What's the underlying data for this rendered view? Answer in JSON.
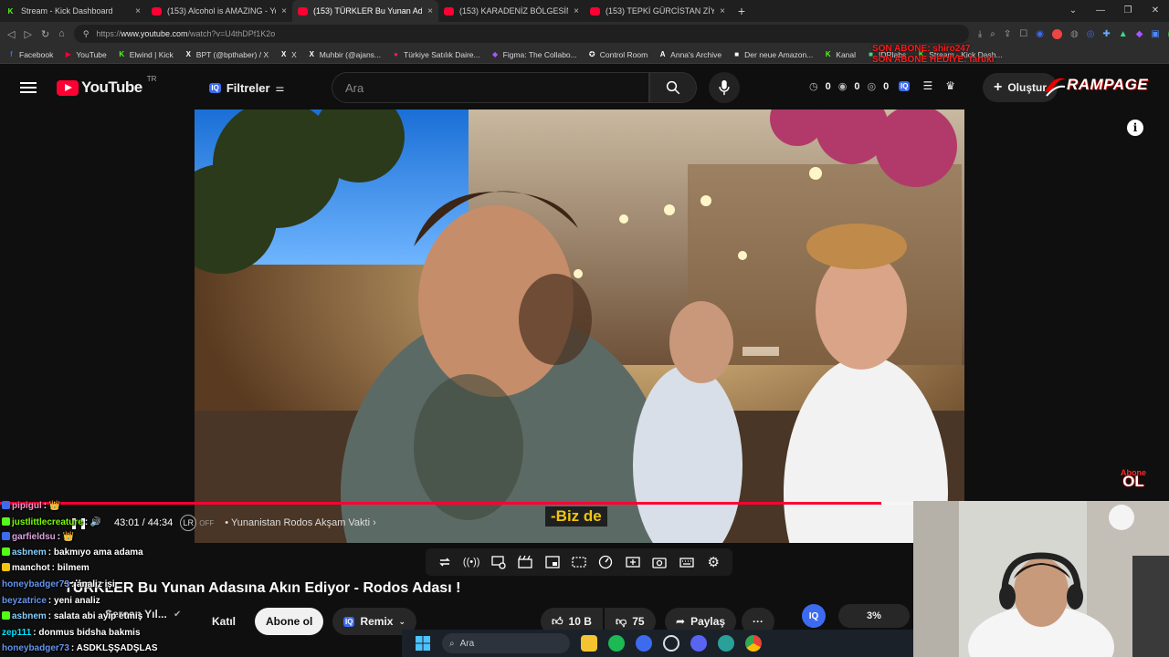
{
  "browser": {
    "tabs": [
      {
        "label": "Stream - Kick Dashboard",
        "icon": "kick"
      },
      {
        "label": "(153) Alcohol is AMAZING - You",
        "icon": "youtube"
      },
      {
        "label": "(153) TÜRKLER Bu Yunan Ad",
        "icon": "youtube"
      },
      {
        "label": "(153) KARADENİZ BÖLGESİNİN",
        "icon": "youtube"
      },
      {
        "label": "(153) TEPKİ GÜRCİSTAN ZİYARE",
        "icon": "youtube"
      }
    ],
    "active_tab_index": 2,
    "close_glyph": "×",
    "newtab_glyph": "+",
    "url_prefix": "https://",
    "url_host": "www.youtube.com",
    "url_path": "/watch?v=U4thDPf1K2o",
    "profile_initial": "U"
  },
  "bookmarks": [
    {
      "label": "Facebook",
      "icon": "f",
      "color": "#1877f2"
    },
    {
      "label": "YouTube",
      "icon": "▶",
      "color": "#ff0033"
    },
    {
      "label": "Elwind | Kick",
      "icon": "K",
      "color": "#53fc18"
    },
    {
      "label": "BPT (@bpthaber) / X",
      "icon": "X",
      "color": "#ffffff"
    },
    {
      "label": "X",
      "icon": "X",
      "color": "#ffffff"
    },
    {
      "label": "Muhbir (@ajans...",
      "icon": "X",
      "color": "#ffffff"
    },
    {
      "label": "Türkiye Satılık Daire...",
      "icon": "●",
      "color": "#e91e63"
    },
    {
      "label": "Figma: The Collabo...",
      "icon": "◆",
      "color": "#a259ff"
    },
    {
      "label": "Control Room",
      "icon": "✪",
      "color": "#ffffff"
    },
    {
      "label": "Anna's Archive",
      "icon": "A",
      "color": "#ffffff"
    },
    {
      "label": "Der neue Amazon...",
      "icon": "■",
      "color": "#ffffff"
    },
    {
      "label": "Kanal",
      "icon": "K",
      "color": "#53fc18"
    },
    {
      "label": "IDRlabs",
      "icon": "■",
      "color": "#3ddc84"
    },
    {
      "label": "Stream - Kick Dash...",
      "icon": "K",
      "color": "#53fc18"
    }
  ],
  "overlay_alert": {
    "line1": "SON ABONE: shiro247",
    "line2": "SON ABONE HEDİYE: faruki"
  },
  "youtube": {
    "logo_text": "YouTube",
    "logo_region": "TR",
    "filter_label": "Filtreler",
    "iq_label": "IQ",
    "search_placeholder": "Ara",
    "stats": [
      "0",
      "0",
      "0"
    ],
    "create_label": "Oluştur",
    "rampage_text": "RAMPAGE"
  },
  "player": {
    "time_current": "43:01",
    "time_total": "44:34",
    "time_sep": " / ",
    "chapter": "Yunanistan Rodos Akşam Vakti",
    "toggle_off": "OFF",
    "subtitle": "-Biz de",
    "progress_fraction": 0.965,
    "sponsor_top": "Abone",
    "sponsor_big": "OL"
  },
  "video_info": {
    "title": "TÜRKLER Bu Yunan Adasına Akın Ediyor - Rodos Adası !",
    "channel": "Sercan Yıl...",
    "join_label": "Katıl",
    "subscribe_label": "Abone ol",
    "remix_label": "Remix",
    "likes": "10 B",
    "dislikes": "75",
    "share_label": "Paylaş",
    "more_label": "···",
    "iq_percent": "3%"
  },
  "chat": [
    {
      "user": "pipigul",
      "text": ": 👑",
      "color": "#ff8ec6",
      "badge": "#3d6bf0"
    },
    {
      "user": "justlittlecreature",
      "text": ": 🔊",
      "color": "#7cfc00",
      "badge": "#53fc18"
    },
    {
      "user": "garfieldsu",
      "text": ": 👑",
      "color": "#dda0dd",
      "badge": "#3d6bf0"
    },
    {
      "user": "asbnem",
      "text": ": bakmıyo ama adama",
      "color": "#87cefa",
      "badge": "#53fc18"
    },
    {
      "user": "manchot",
      "text": ": bilmem",
      "color": "#ffffff",
      "badge": "#f1c40f"
    },
    {
      "user": "honeybadger73",
      "text": ": analiz işi",
      "color": "#6495ed",
      "badge": ""
    },
    {
      "user": "beyzatrice",
      "text": ": yeni analiz",
      "color": "#6495ed",
      "badge": ""
    },
    {
      "user": "asbnem",
      "text": ": salata abi ayip etmiş",
      "color": "#87cefa",
      "badge": "#53fc18"
    },
    {
      "user": "zep111",
      "text": ": donmus bidsha bakmis",
      "color": "#00e5ff",
      "badge": ""
    },
    {
      "user": "honeybadger73",
      "text": ": ASDKLŞŞADŞLAS",
      "color": "#6495ed",
      "badge": ""
    }
  ],
  "taskbar": {
    "search_label": "Ara"
  }
}
